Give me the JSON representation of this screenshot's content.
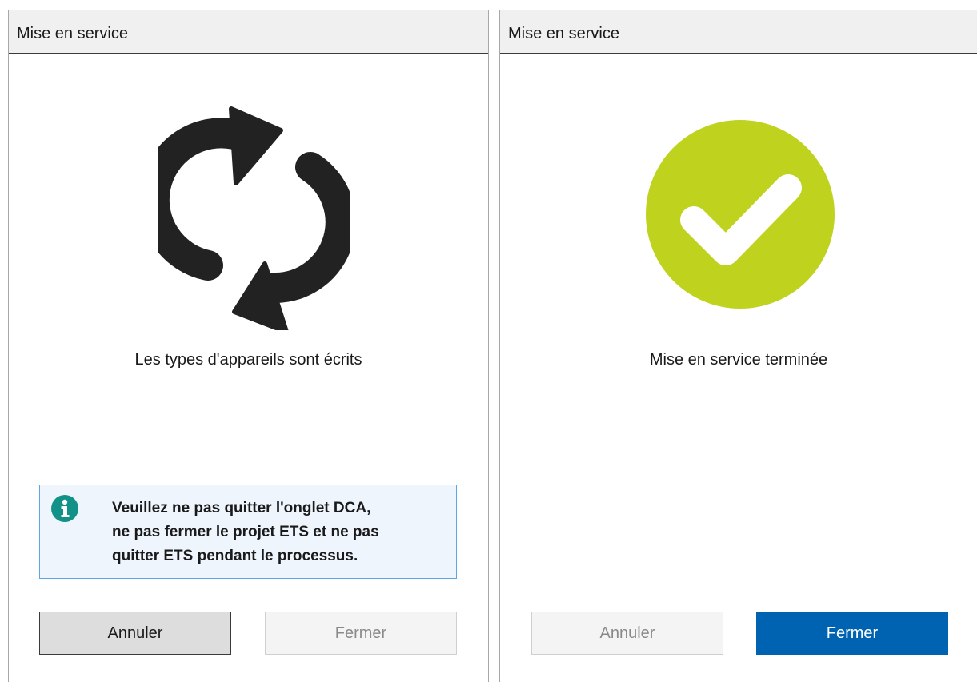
{
  "left_panel": {
    "title": "Mise en service",
    "status_icon": "sync-arrows-icon",
    "status_text": "Les types d'appareils sont écrits",
    "info": {
      "icon": "info-icon",
      "lines": [
        "Veuillez ne pas quitter l'onglet DCA,",
        "ne pas fermer le projet ETS et ne pas",
        "quitter ETS pendant le processus."
      ]
    },
    "buttons": {
      "cancel_label": "Annuler",
      "close_label": "Fermer"
    }
  },
  "right_panel": {
    "title": "Mise en service",
    "status_icon": "check-circle-icon",
    "status_text": "Mise en service terminée",
    "buttons": {
      "cancel_label": "Annuler",
      "close_label": "Fermer"
    }
  },
  "colors": {
    "success": "#bfd31e",
    "info_accent": "#129189",
    "primary_button": "#0063b1",
    "icon_dark": "#222222"
  }
}
